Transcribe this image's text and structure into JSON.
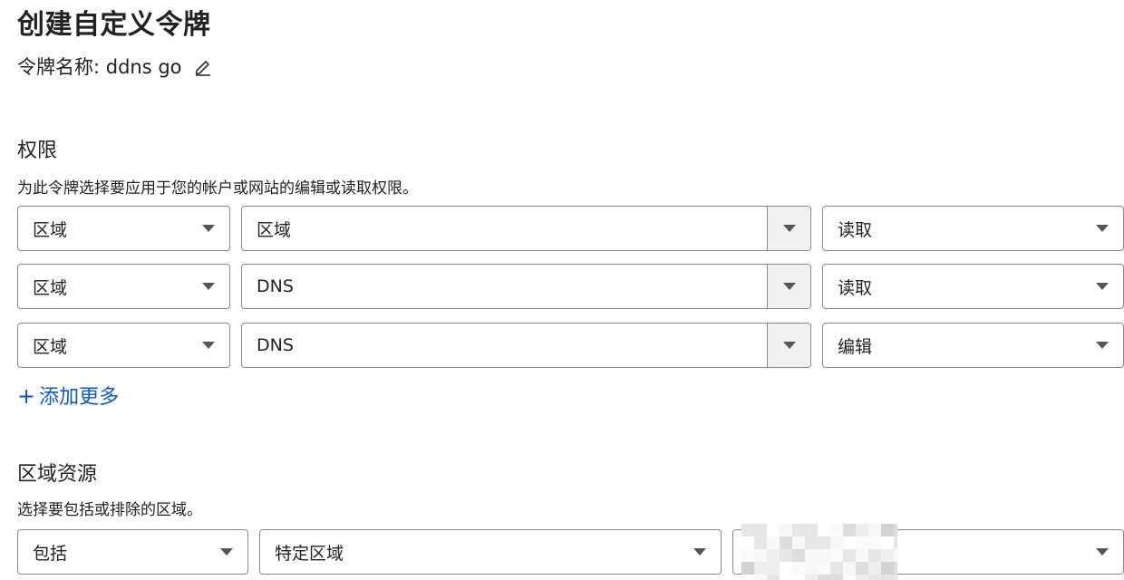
{
  "page": {
    "title": "创建自定义令牌",
    "token_name_label": "令牌名称: ddns go"
  },
  "permissions": {
    "title": "权限",
    "description": "为此令牌选择要应用于您的帐户或网站的编辑或读取权限。",
    "rows": [
      {
        "scope": "区域",
        "resource": "区域",
        "access": "读取"
      },
      {
        "scope": "区域",
        "resource": "DNS",
        "access": "读取"
      },
      {
        "scope": "区域",
        "resource": "DNS",
        "access": "编辑"
      }
    ],
    "add_more_icon": "plus-icon",
    "add_more_label": "添加更多"
  },
  "zone_resources": {
    "title": "区域资源",
    "description": "选择要包括或排除的区域。",
    "include": "包括",
    "type": "特定区域",
    "zone_value_redacted": true
  },
  "colors": {
    "link": "#0a5cc2",
    "border": "#8a8a8a",
    "caret_bg": "#f1f1f1"
  }
}
